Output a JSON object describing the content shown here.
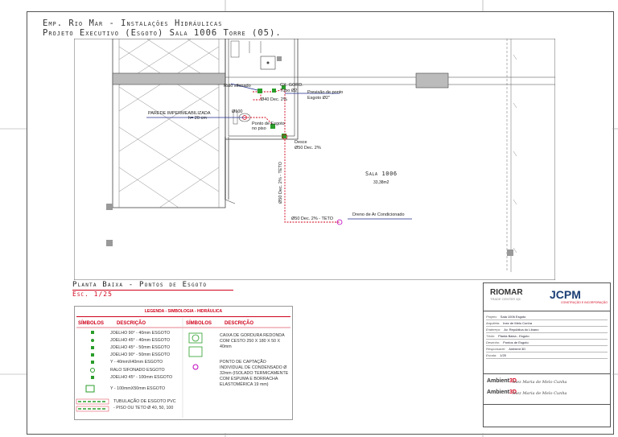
{
  "header": {
    "line1": "Emp. Rio Mar - Instalações Hidráulicas",
    "line2": "Projeto Executivo (Esgoto) Sala 1006 Torre (05)."
  },
  "plan": {
    "room_name": "Sala 1006",
    "room_area": "33,38m2",
    "labels": {
      "ralo": "Ralo sifonado",
      "cx_gordura": "CX. GORD.",
      "tubo": "Tubo Ø2",
      "d40": "Ø40 Dec. 2%",
      "previsao1": "Previsão de ponto",
      "previsao2": "Esgoto Ø2\"",
      "parede1": "PAREDE IMPERMEABILIZADA",
      "parede2": "h= 20 cm",
      "d100": "Ø100",
      "ponto1": "Ponto de Esgoto",
      "ponto2": "no piso",
      "desce": "Desce",
      "d50a": "Ø50 Dec. 2%",
      "d50v": "Ø50 Dec. 2% - TETO",
      "d50b": "Ø50 Dec. 2% - TETO",
      "dreno": "Dreno de Ar Condicionado"
    }
  },
  "caption": {
    "title": "Planta Baixa - Pontos de Esgoto",
    "scale": "Esc. 1/25"
  },
  "legend": {
    "title": "LEGENDA - SIMBOLOGIA - HIDRÁULICA",
    "col_simbolos": "SÍMBOLOS",
    "col_descricao": "DESCRIÇÃO",
    "col_simbolos2": "SÍMBOLOS",
    "col_descricao2": "DESCRIÇÃO",
    "items": [
      "JOELHO 90° - 40mm ESGOTO",
      "JOELHO 45° - 40mm ESGOTO",
      "JOELHO 45° - 50mm ESGOTO",
      "JOELHO 90° - 50mm ESGOTO",
      "Y - 40mmX40mm ESGOTO",
      "RALO SIFONADO ESGOTO",
      "JOELHO 45° - 100mm ESGOTO",
      "Y - 100mmX50mm ESGOTO"
    ],
    "pipe_desc1": "TUBULAÇÃO DE ESGOTO PVC",
    "pipe_desc2": "- PISO OU TETO Ø 40, 50, 100",
    "right_items": [
      "CAIXA DE GORDURA REDONDA COM CESTO 250 X 180 X 50 X 40mm",
      "PONTO DE CAPTAÇÃO INDIVIDUAL DE CONDENSADO Ø 32mm (ISOLADO TERMICAMENTE COM ESPUMA E BORRACHA ELASTOMÉRICA 19 mm)"
    ]
  },
  "titleblock": {
    "logo1": "RIOMAR",
    "logo1_sub": "TRADE CENTER 4|5",
    "logo2": "JCPM",
    "logo2_sub": "CONSTRUÇÃO E INCORPORAÇÃO",
    "fields": [
      {
        "k": "Projeto:",
        "v": "Sala 1006 Esgoto"
      },
      {
        "k": "Arquiteta:",
        "v": "Inez de Melo Cunha"
      },
      {
        "k": "Endereço:",
        "v": "Av. República do Líbano"
      },
      {
        "k": "Título:",
        "v": "Planta Baixa - Esgoto"
      },
      {
        "k": "Desenho:",
        "v": "Pontos de Esgoto"
      },
      {
        "k": "Responsável:",
        "v": "Ambient 3D"
      },
      {
        "k": "Escala:",
        "v": "1/25"
      }
    ],
    "amb1": "Ambient",
    "amb1b": "3D",
    "amb2": "Ambient",
    "amb2b": "3D",
    "sig": "Inez Maria de Melo Cunha"
  }
}
